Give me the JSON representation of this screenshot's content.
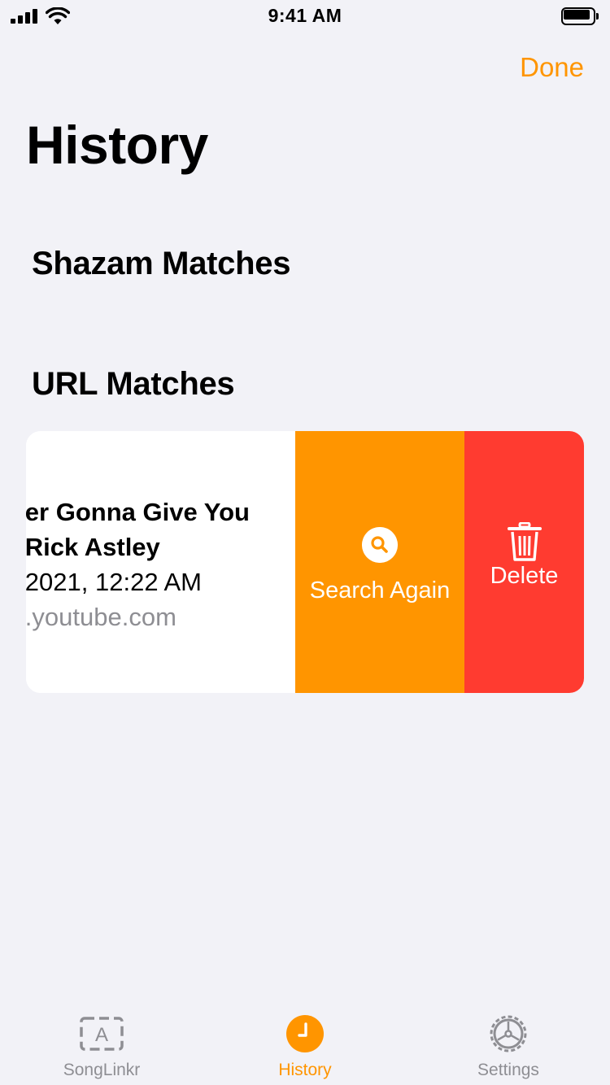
{
  "status_bar": {
    "time": "9:41 AM"
  },
  "nav": {
    "done_label": "Done",
    "title": "History"
  },
  "sections": {
    "shazam_title": "Shazam Matches",
    "url_title": "URL Matches"
  },
  "row": {
    "title": "er Gonna Give You",
    "artist": "Rick Astley",
    "date": "2021, 12:22 AM",
    "domain": ".youtube.com",
    "actions": {
      "search_label": "Search Again",
      "delete_label": "Delete"
    }
  },
  "tab_bar": {
    "tabs": [
      {
        "label": "SongLinkr",
        "icon": "app-store-icon",
        "active": false
      },
      {
        "label": "History",
        "icon": "clock-icon",
        "active": true
      },
      {
        "label": "Settings",
        "icon": "gear-icon",
        "active": false
      }
    ]
  },
  "colors": {
    "accent": "#ff9500",
    "delete": "#ff3b30",
    "background": "#f2f2f7",
    "inactive": "#8e8e93"
  }
}
